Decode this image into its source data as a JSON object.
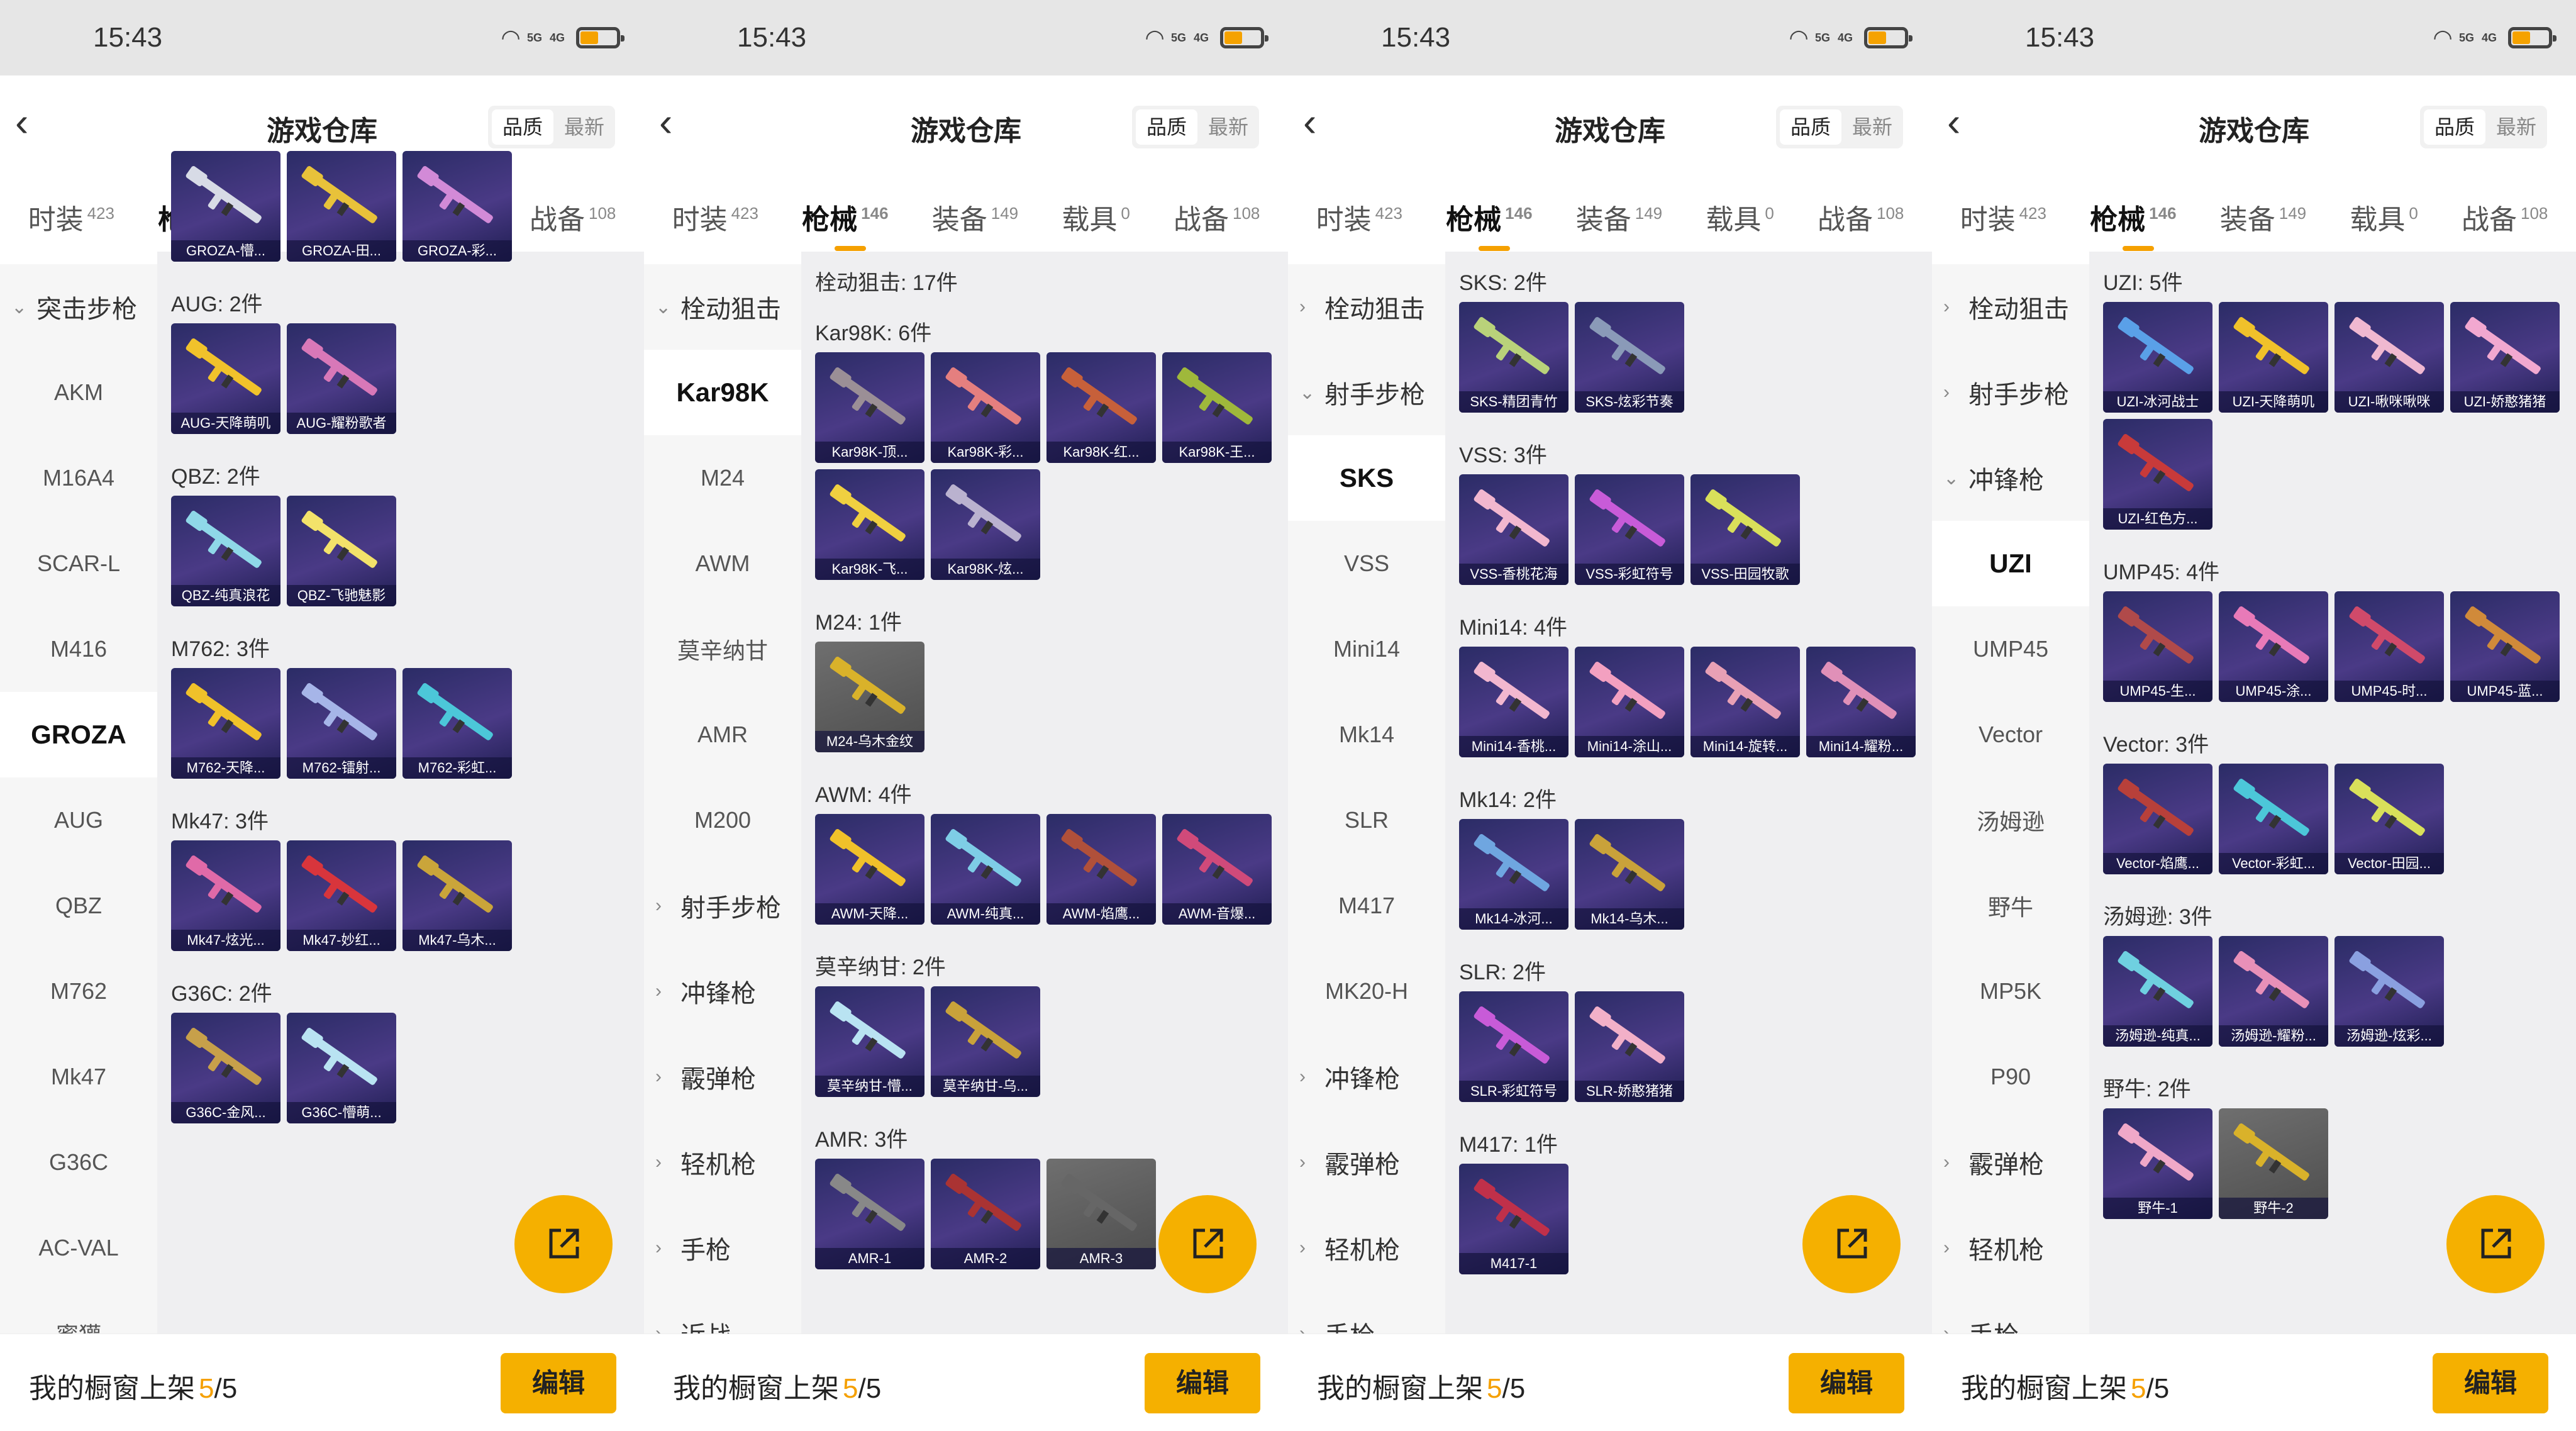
{
  "status": {
    "time": "15:43",
    "net1": "5G",
    "net2": "4G"
  },
  "header": {
    "title": "游戏仓库",
    "sort_options": [
      "品质",
      "最新"
    ]
  },
  "tabs": [
    {
      "label": "时装",
      "count": "423"
    },
    {
      "label": "枪械",
      "count": "146"
    },
    {
      "label": "装备",
      "count": "149"
    },
    {
      "label": "载具",
      "count": "0"
    },
    {
      "label": "战备",
      "count": "108"
    }
  ],
  "footer": {
    "label": "我的橱窗上架",
    "count": "5",
    "total": "/5",
    "edit_label": "编辑"
  },
  "colors": {
    "accent": "#f5a000",
    "fab": "#f5b000"
  },
  "icons": [
    "back-chevron-icon",
    "wifi-icon",
    "signal-icon",
    "battery-icon",
    "share-icon",
    "chevron-down-icon",
    "chevron-right-icon"
  ],
  "panels": [
    {
      "sidebar": [
        {
          "label": "突击步枪",
          "type": "cat",
          "open": true
        },
        {
          "label": "AKM"
        },
        {
          "label": "M16A4"
        },
        {
          "label": "SCAR-L"
        },
        {
          "label": "M416"
        },
        {
          "label": "GROZA",
          "selected": true
        },
        {
          "label": "AUG"
        },
        {
          "label": "QBZ"
        },
        {
          "label": "M762"
        },
        {
          "label": "Mk47"
        },
        {
          "label": "G36C"
        },
        {
          "label": "AC-VAL"
        },
        {
          "label": "蜜獾"
        }
      ],
      "sections": [
        {
          "title": "",
          "start_row": -0.8,
          "items": [
            {
              "name": "GROZA-懵...",
              "c": "#d7dbe6"
            },
            {
              "name": "GROZA-田...",
              "c": "#e8c23a"
            },
            {
              "name": "GROZA-彩...",
              "c": "#d28ad7"
            }
          ]
        },
        {
          "title": "AUG: 2件",
          "items": [
            {
              "name": "AUG-天降萌叽",
              "c": "#f1c22b"
            },
            {
              "name": "AUG-耀粉歌者",
              "c": "#d878b8"
            }
          ]
        },
        {
          "title": "QBZ: 2件",
          "items": [
            {
              "name": "QBZ-纯真浪花",
              "c": "#8fd8e8"
            },
            {
              "name": "QBZ-飞驰魅影",
              "c": "#f3e26a"
            }
          ]
        },
        {
          "title": "M762: 3件",
          "items": [
            {
              "name": "M762-天降...",
              "c": "#f0c12a"
            },
            {
              "name": "M762-镭射...",
              "c": "#a6b5e8"
            },
            {
              "name": "M762-彩虹...",
              "c": "#4cc7d9"
            }
          ]
        },
        {
          "title": "Mk47: 3件",
          "items": [
            {
              "name": "Mk47-炫光...",
              "c": "#e06aa8"
            },
            {
              "name": "Mk47-妙红...",
              "c": "#d8353c"
            },
            {
              "name": "Mk47-乌木...",
              "c": "#caa53a"
            }
          ]
        },
        {
          "title": "G36C: 2件",
          "items": [
            {
              "name": "G36C-金风...",
              "c": "#c7a04a"
            },
            {
              "name": "G36C-懵萌...",
              "c": "#b9e3f2"
            }
          ]
        }
      ]
    },
    {
      "sidebar": [
        {
          "label": "栓动狙击",
          "type": "cat",
          "open": true
        },
        {
          "label": "Kar98K",
          "selected": true
        },
        {
          "label": "M24"
        },
        {
          "label": "AWM"
        },
        {
          "label": "莫辛纳甘"
        },
        {
          "label": "AMR"
        },
        {
          "label": "M200"
        },
        {
          "label": "射手步枪",
          "type": "cat"
        },
        {
          "label": "冲锋枪",
          "type": "cat"
        },
        {
          "label": "霰弹枪",
          "type": "cat"
        },
        {
          "label": "轻机枪",
          "type": "cat"
        },
        {
          "label": "手枪",
          "type": "cat"
        },
        {
          "label": "近战",
          "type": "cat"
        }
      ],
      "sections": [
        {
          "title": "栓动狙击: 17件",
          "start_row": 0,
          "items": []
        },
        {
          "title": "Kar98K: 6件",
          "items": [
            {
              "name": "Kar98K-顶...",
              "c": "#9b8f96"
            },
            {
              "name": "Kar98K-彩...",
              "c": "#e57f7f"
            },
            {
              "name": "Kar98K-红...",
              "c": "#c7603a"
            },
            {
              "name": "Kar98K-王...",
              "c": "#9fb83b"
            },
            {
              "name": "Kar98K-飞...",
              "c": "#f0d040"
            },
            {
              "name": "Kar98K-炫...",
              "c": "#bab2cf"
            }
          ]
        },
        {
          "title": "M24: 1件",
          "items": [
            {
              "name": "M24-乌木金纹",
              "c": "#d9b22a",
              "gray": true
            }
          ]
        },
        {
          "title": "AWM: 4件",
          "items": [
            {
              "name": "AWM-天降...",
              "c": "#f0c12a"
            },
            {
              "name": "AWM-纯真...",
              "c": "#7ecde6"
            },
            {
              "name": "AWM-焰鹰...",
              "c": "#b0503a"
            },
            {
              "name": "AWM-音爆...",
              "c": "#d04a7a"
            }
          ]
        },
        {
          "title": "莫辛纳甘: 2件",
          "items": [
            {
              "name": "莫辛纳甘-懵...",
              "c": "#b9e3f2"
            },
            {
              "name": "莫辛纳甘-乌...",
              "c": "#c9a23a"
            }
          ]
        },
        {
          "title": "AMR: 3件",
          "items": [
            {
              "name": "AMR-1",
              "c": "#888"
            },
            {
              "name": "AMR-2",
              "c": "#a33"
            },
            {
              "name": "AMR-3",
              "c": "#666",
              "gray": true
            }
          ]
        }
      ]
    },
    {
      "sidebar": [
        {
          "label": "栓动狙击",
          "type": "cat"
        },
        {
          "label": "射手步枪",
          "type": "cat",
          "open": true
        },
        {
          "label": "SKS",
          "selected": true
        },
        {
          "label": "VSS"
        },
        {
          "label": "Mini14"
        },
        {
          "label": "Mk14"
        },
        {
          "label": "SLR"
        },
        {
          "label": "M417"
        },
        {
          "label": "MK20-H"
        },
        {
          "label": "冲锋枪",
          "type": "cat"
        },
        {
          "label": "霰弹枪",
          "type": "cat"
        },
        {
          "label": "轻机枪",
          "type": "cat"
        },
        {
          "label": "手枪",
          "type": "cat"
        }
      ],
      "sections": [
        {
          "title": "SKS: 2件",
          "start_row": 0,
          "items": [
            {
              "name": "SKS-精团青竹",
              "c": "#b9d27a"
            },
            {
              "name": "SKS-炫彩节奏",
              "c": "#8a9ab8"
            }
          ]
        },
        {
          "title": "VSS: 3件",
          "items": [
            {
              "name": "VSS-香桃花海",
              "c": "#f2b7cf"
            },
            {
              "name": "VSS-彩虹符号",
              "c": "#c85bd8"
            },
            {
              "name": "VSS-田园牧歌",
              "c": "#d9e05a"
            }
          ]
        },
        {
          "title": "Mini14: 4件",
          "items": [
            {
              "name": "Mini14-香桃...",
              "c": "#f2b7cf"
            },
            {
              "name": "Mini14-涂山...",
              "c": "#f3a0c0"
            },
            {
              "name": "Mini14-旋转...",
              "c": "#e8a0b5"
            },
            {
              "name": "Mini14-耀粉...",
              "c": "#e090b8"
            }
          ]
        },
        {
          "title": "Mk14: 2件",
          "items": [
            {
              "name": "Mk14-冰河...",
              "c": "#6fa6e0"
            },
            {
              "name": "Mk14-乌木...",
              "c": "#c9a23a"
            }
          ]
        },
        {
          "title": "SLR: 2件",
          "items": [
            {
              "name": "SLR-彩虹符号",
              "c": "#c85bd8"
            },
            {
              "name": "SLR-娇憨猪猪",
              "c": "#f2b0c8"
            }
          ]
        },
        {
          "title": "M417: 1件",
          "items": [
            {
              "name": "M417-1",
              "c": "#c0304a"
            }
          ]
        }
      ]
    },
    {
      "sidebar": [
        {
          "label": "栓动狙击",
          "type": "cat"
        },
        {
          "label": "射手步枪",
          "type": "cat"
        },
        {
          "label": "冲锋枪",
          "type": "cat",
          "open": true
        },
        {
          "label": "UZI",
          "selected": true
        },
        {
          "label": "UMP45"
        },
        {
          "label": "Vector"
        },
        {
          "label": "汤姆逊"
        },
        {
          "label": "野牛"
        },
        {
          "label": "MP5K"
        },
        {
          "label": "P90"
        },
        {
          "label": "霰弹枪",
          "type": "cat"
        },
        {
          "label": "轻机枪",
          "type": "cat"
        },
        {
          "label": "手枪",
          "type": "cat"
        }
      ],
      "sections": [
        {
          "title": "UZI: 5件",
          "start_row": 0,
          "items": [
            {
              "name": "UZI-冰河战士",
              "c": "#5aa0e8"
            },
            {
              "name": "UZI-天降萌叽",
              "c": "#f0c12a"
            },
            {
              "name": "UZI-啾咪啾咪",
              "c": "#f0b8d0"
            },
            {
              "name": "UZI-娇憨猪猪",
              "c": "#f2a8d0"
            },
            {
              "name": "UZI-红色方...",
              "c": "#c83a3a"
            }
          ]
        },
        {
          "title": "UMP45: 4件",
          "items": [
            {
              "name": "UMP45-生...",
              "c": "#b04a4a"
            },
            {
              "name": "UMP45-涂...",
              "c": "#e87ab8"
            },
            {
              "name": "UMP45-时...",
              "c": "#d04a6a"
            },
            {
              "name": "UMP45-蓝...",
              "c": "#d08a3a"
            }
          ]
        },
        {
          "title": "Vector: 3件",
          "items": [
            {
              "name": "Vector-焰鹰...",
              "c": "#b8403a"
            },
            {
              "name": "Vector-彩虹...",
              "c": "#4cc7d9"
            },
            {
              "name": "Vector-田园...",
              "c": "#d9e05a"
            }
          ]
        },
        {
          "title": "汤姆逊: 3件",
          "items": [
            {
              "name": "汤姆逊-纯真...",
              "c": "#6fd0e0"
            },
            {
              "name": "汤姆逊-耀粉...",
              "c": "#e890b8"
            },
            {
              "name": "汤姆逊-炫彩...",
              "c": "#8aa0e0"
            }
          ]
        },
        {
          "title": "野牛: 2件",
          "items": [
            {
              "name": "野牛-1",
              "c": "#f0a8c8"
            },
            {
              "name": "野牛-2",
              "c": "#d9b22a",
              "gray": true
            }
          ]
        }
      ]
    }
  ]
}
